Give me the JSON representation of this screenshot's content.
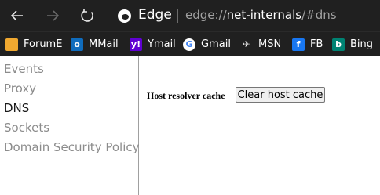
{
  "browser": {
    "brand": "Edge",
    "url_prefix": "edge://",
    "url_host": "net-internals",
    "url_path": "/#dns"
  },
  "bookmarks": [
    {
      "label": "ForumE",
      "icon": "folder-icon",
      "color": "#f0a830"
    },
    {
      "label": "MMail",
      "icon": "outlook-icon",
      "color": "#0f6cbd"
    },
    {
      "label": "Ymail",
      "icon": "yahoo-icon",
      "color": "#6001d2"
    },
    {
      "label": "Gmail",
      "icon": "google-icon",
      "color": "#4285f4"
    },
    {
      "label": "MSN",
      "icon": "msn-icon",
      "color": "#ffffff"
    },
    {
      "label": "FB",
      "icon": "facebook-icon",
      "color": "#1877f2"
    },
    {
      "label": "Bing",
      "icon": "bing-icon",
      "color": "#008373"
    }
  ],
  "sidebar": {
    "items": [
      {
        "label": "Events",
        "active": false
      },
      {
        "label": "Proxy",
        "active": false
      },
      {
        "label": "DNS",
        "active": true
      },
      {
        "label": "Sockets",
        "active": false
      },
      {
        "label": "Domain Security Policy",
        "active": false
      }
    ]
  },
  "main": {
    "host_resolver_label": "Host resolver cache",
    "clear_button": "Clear host cache"
  }
}
